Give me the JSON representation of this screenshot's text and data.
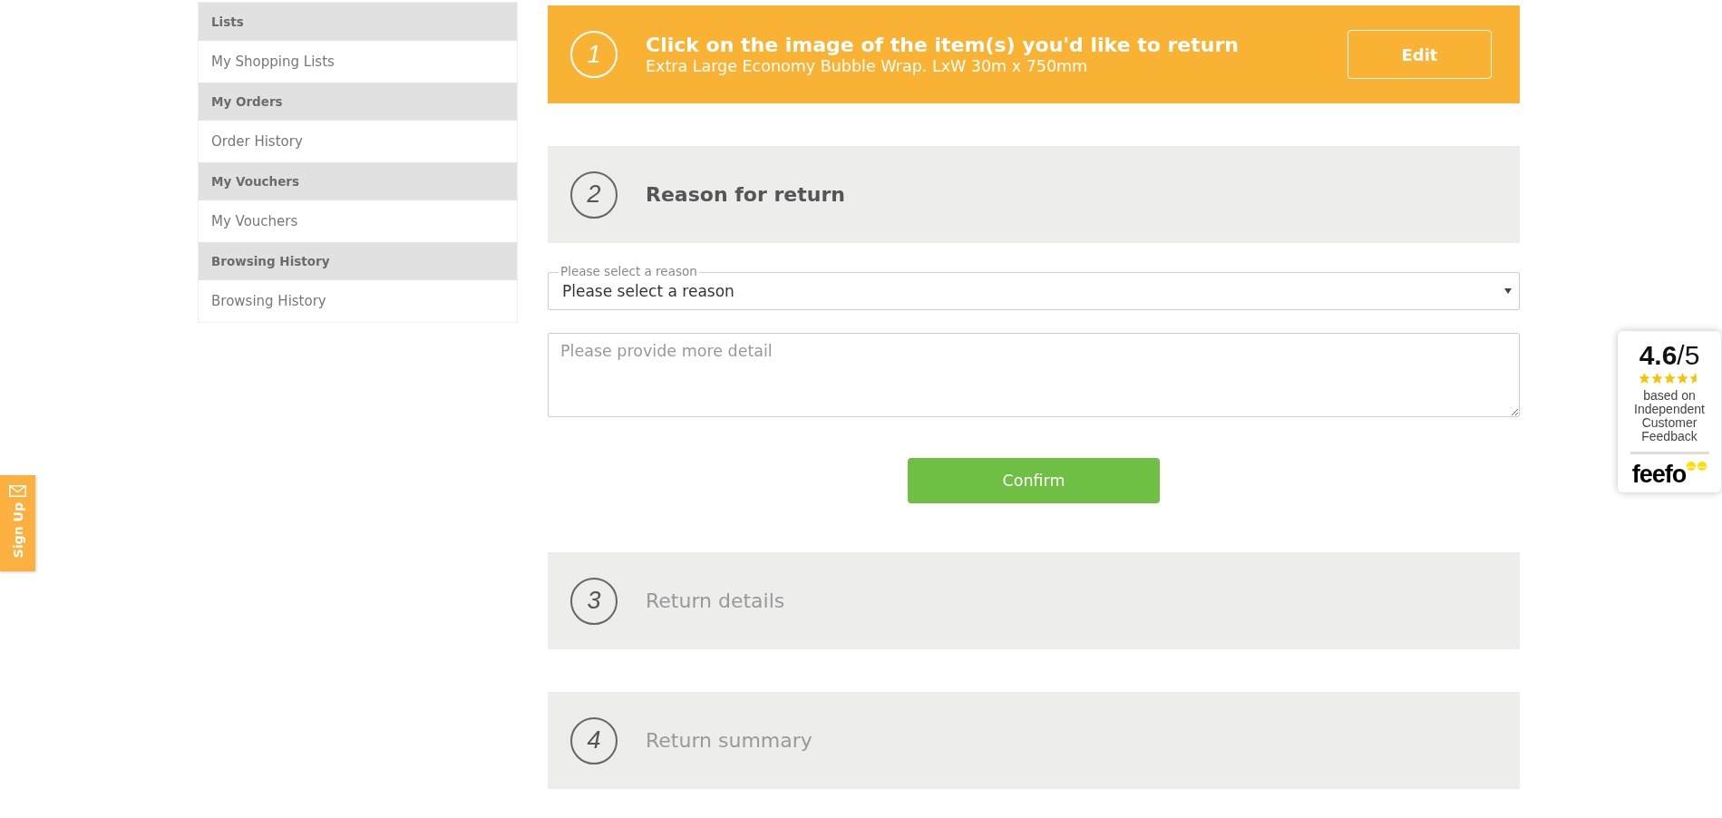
{
  "sidebar": {
    "sections": [
      {
        "heading": "Lists",
        "items": [
          {
            "label": "My Shopping Lists"
          }
        ]
      },
      {
        "heading": "My Orders",
        "items": [
          {
            "label": "Order History"
          }
        ]
      },
      {
        "heading": "My Vouchers",
        "items": [
          {
            "label": "My Vouchers"
          }
        ]
      },
      {
        "heading": "Browsing History",
        "items": [
          {
            "label": "Browsing History"
          }
        ]
      }
    ]
  },
  "steps": [
    {
      "number": "1",
      "title": "Click on the image of the item(s) you'd like to return",
      "subtitle": "Extra Large Economy Bubble Wrap. LxW 30m x 750mm",
      "kind": "done",
      "action": "Edit"
    },
    {
      "number": "2",
      "title": "Reason for return",
      "kind": "current",
      "form": {
        "select": {
          "label": "Please select a reason",
          "value": "Please select a reason"
        },
        "details": {
          "placeholder": "Please provide more detail"
        },
        "confirm_button": "Confirm"
      }
    },
    {
      "number": "3",
      "title": "Return details",
      "kind": "pending"
    },
    {
      "number": "4",
      "title": "Return summary",
      "kind": "pending"
    }
  ],
  "signup_tab": {
    "label": "Sign Up"
  },
  "rating_widget": {
    "score": "**4.6**/5",
    "stars": 4.6,
    "caption": "based on Independent Customer Feedback",
    "brand": "feefo"
  }
}
